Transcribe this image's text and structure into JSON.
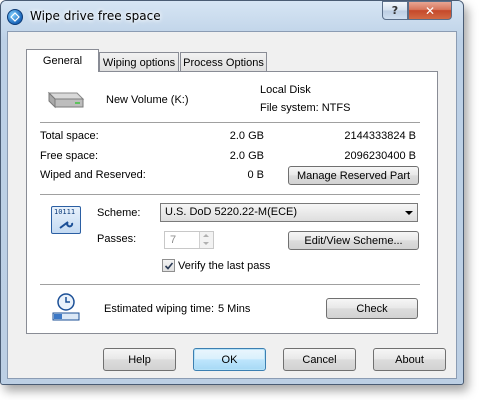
{
  "window": {
    "title": "Wipe drive free space",
    "help_glyph": "?",
    "close_glyph": "✕"
  },
  "tabs": [
    {
      "label": "General",
      "selected": true
    },
    {
      "label": "Wiping options",
      "selected": false
    },
    {
      "label": "Process Options",
      "selected": false
    }
  ],
  "drive": {
    "name": "New Volume (K:)",
    "type": "Local Disk",
    "filesystem": "File system: NTFS"
  },
  "space": {
    "total_label": "Total space:",
    "total_size": "2.0 GB",
    "total_bytes": "2144333824 B",
    "free_label": "Free space:",
    "free_size": "2.0 GB",
    "free_bytes": "2096230400 B",
    "wiped_label": "Wiped and Reserved:",
    "wiped_size": "0 B",
    "manage_button": "Manage Reserved Part"
  },
  "scheme": {
    "icon_text": "10111",
    "label": "Scheme:",
    "selected": "U.S. DoD 5220.22-M(ECE)",
    "passes_label": "Passes:",
    "passes_value": "7",
    "edit_button": "Edit/View Scheme...",
    "verify_label": "Verify the last pass",
    "verify_checked": true
  },
  "estimate": {
    "label": "Estimated wiping time:",
    "value": "5 Mins",
    "check_button": "Check"
  },
  "buttons": {
    "help": "Help",
    "ok": "OK",
    "cancel": "Cancel",
    "about": "About"
  }
}
